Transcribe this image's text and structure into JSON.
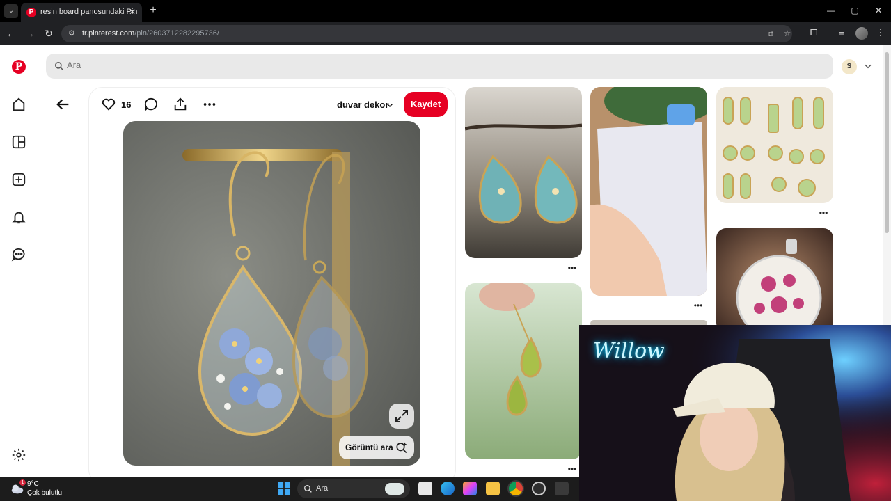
{
  "browser": {
    "tab_title": "resin board panosundaki Pin",
    "url_host": "tr.pinterest.com",
    "url_path": "/pin/2603712282295736/",
    "tab_close": "✕",
    "new_tab": "+",
    "window_controls": {
      "minimize": "—",
      "maximize": "▢",
      "close": "✕"
    }
  },
  "pinterest": {
    "brand_color": "#e60023",
    "search": {
      "placeholder": "Ara"
    },
    "user": {
      "initial": "S"
    },
    "sidebar": [
      "home-icon",
      "explore-icon",
      "create-icon",
      "notifications-icon",
      "messages-icon",
      "settings-icon"
    ],
    "pin": {
      "like_count": "16",
      "board_name": "duvar dekor",
      "save_label": "Kaydet",
      "visual_search_label": "Görüntü ara"
    },
    "more_label": "•••"
  },
  "webcam": {
    "neon_text": "Willow"
  },
  "taskbar": {
    "temperature": "9°C",
    "condition": "Çok bulutlu",
    "weather_badge": "1",
    "search_label": "Ara"
  }
}
